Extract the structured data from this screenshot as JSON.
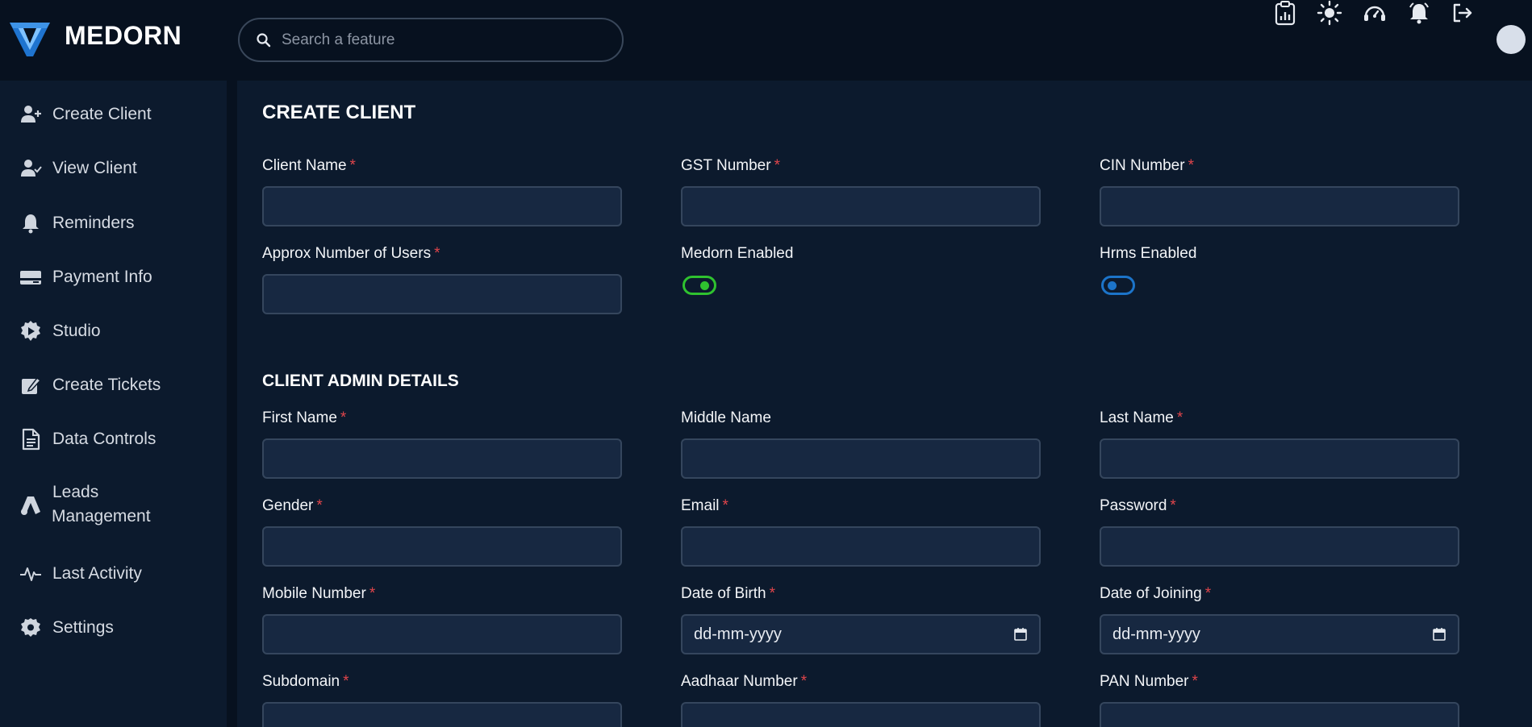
{
  "header": {
    "brand": "MEDORN",
    "search_placeholder": "Search a feature"
  },
  "sidebar": {
    "items": [
      {
        "label": "Create Client",
        "icon": "user-plus-icon"
      },
      {
        "label": "View Client",
        "icon": "user-check-icon"
      },
      {
        "label": "Reminders",
        "icon": "bell-icon"
      },
      {
        "label": "Payment Info",
        "icon": "credit-card-icon"
      },
      {
        "label": "Studio",
        "icon": "gear-puzzle-icon"
      },
      {
        "label": "Create Tickets",
        "icon": "edit-icon"
      },
      {
        "label": "Data Controls",
        "icon": "document-icon"
      },
      {
        "label": "Leads",
        "label2": "Management",
        "icon": "leads-icon"
      },
      {
        "label": "Last Activity",
        "icon": "activity-icon"
      },
      {
        "label": "Settings",
        "icon": "settings-icon"
      }
    ]
  },
  "form": {
    "title": "CREATE CLIENT",
    "admin_title": "CLIENT ADMIN DETAILS",
    "required_mark": "*",
    "client_name": "Client Name",
    "gst_number": "GST Number",
    "cin_number": "CIN Number",
    "approx_users": "Approx Number of Users",
    "medorn_enabled": "Medorn Enabled",
    "hrms_enabled": "Hrms Enabled",
    "first_name": "First Name",
    "middle_name": "Middle Name",
    "last_name": "Last Name",
    "gender": "Gender",
    "email": "Email",
    "password": "Password",
    "mobile_number": "Mobile Number",
    "date_of_birth": "Date of Birth",
    "date_of_joining": "Date of Joining",
    "date_placeholder": "dd-mm-yyyy",
    "subdomain": "Subdomain",
    "aadhaar_number": "Aadhaar Number",
    "pan_number": "PAN Number"
  },
  "toggles": {
    "medorn_on": true,
    "hrms_on": false,
    "medorn_color": "#2fc22f",
    "hrms_color": "#1c74c9"
  },
  "colors": {
    "required": "#e0454b",
    "background": "#07111f",
    "panel": "#0c1a2d",
    "input": "#172841"
  }
}
